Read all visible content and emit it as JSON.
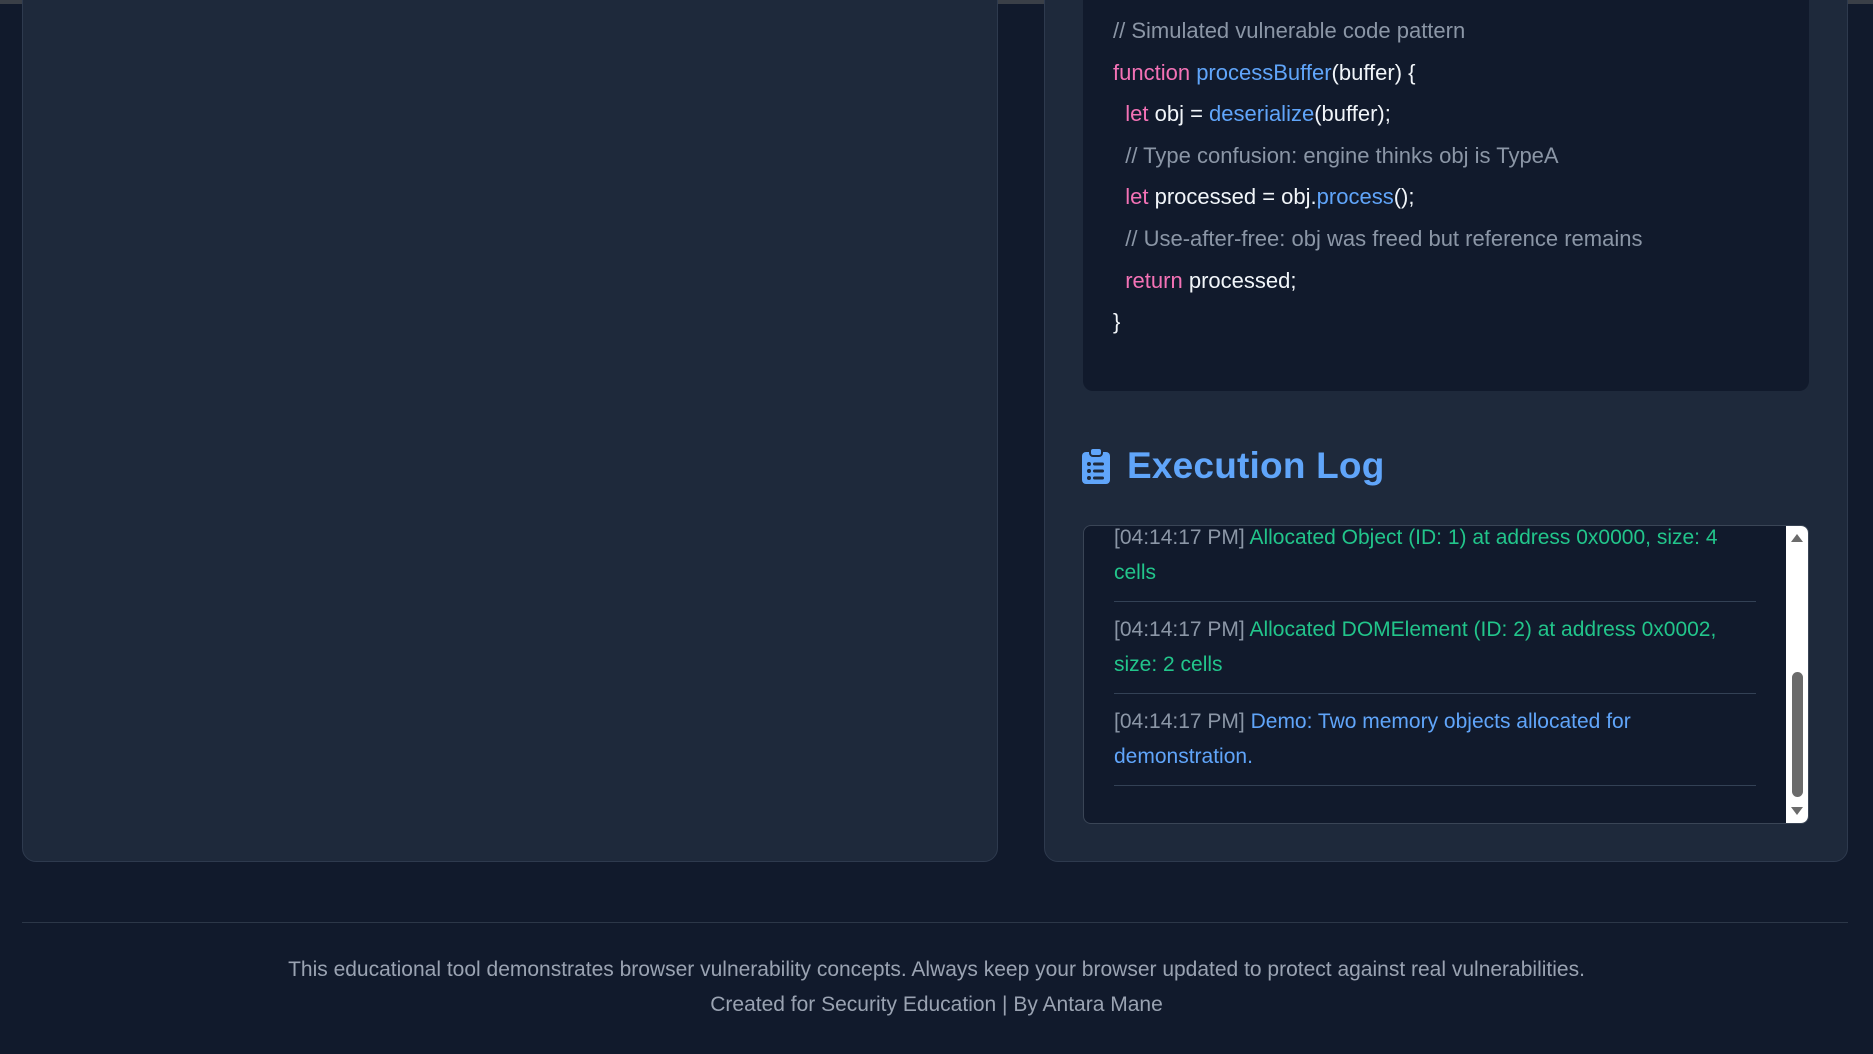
{
  "code": {
    "line1": "// Simulated vulnerable code pattern",
    "line2": {
      "kw": "function",
      "fn": "processBuffer",
      "rest": "(buffer) {"
    },
    "line3": {
      "kw": "let",
      "plain1": " obj = ",
      "fn": "deserialize",
      "plain2": "(buffer);"
    },
    "line4": "// Type confusion: engine thinks obj is TypeA",
    "line5": {
      "kw": "let",
      "plain1": " processed = obj.",
      "fn": "process",
      "plain2": "();"
    },
    "line6": "// Use-after-free: obj was freed but reference remains",
    "line7": {
      "kw": "return",
      "plain": " processed;"
    },
    "line8": "}"
  },
  "log": {
    "title": "Execution Log",
    "icon": "clipboard-list-icon",
    "entries": [
      {
        "time": "[04:14:17 PM]",
        "message": "Allocated Object (ID: 1) at address 0x0000, size: 4 cells",
        "type": "success"
      },
      {
        "time": "[04:14:17 PM]",
        "message": "Allocated DOMElement (ID: 2) at address 0x0002, size: 2 cells",
        "type": "success"
      },
      {
        "time": "[04:14:17 PM]",
        "message": "Demo: Two memory objects allocated for demonstration.",
        "type": "info"
      }
    ]
  },
  "footer": {
    "line1": "This educational tool demonstrates browser vulnerability concepts. Always keep your browser updated to protect against real vulnerabilities.",
    "line2": "Created for Security Education | By Antara Mane"
  },
  "colors": {
    "background": "#111a2c",
    "panel": "#1e293b",
    "accent": "#60a5fa",
    "success": "#22c58b",
    "keyword": "#f472b6"
  }
}
